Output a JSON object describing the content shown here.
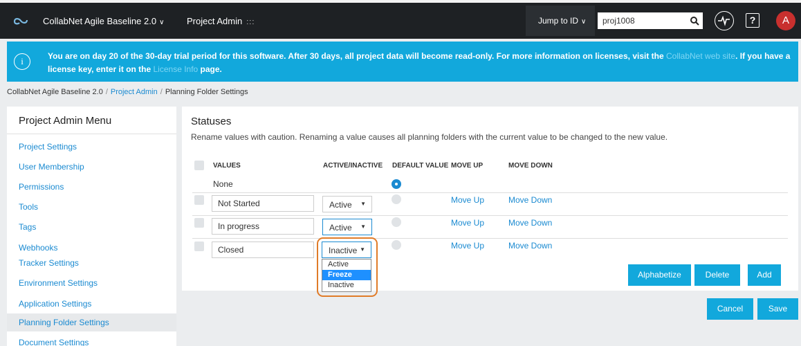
{
  "topbar": {
    "app_title": "CollabNet Agile Baseline 2.0",
    "section_title": "Project Admin",
    "grid_icon": ":::",
    "jump_label": "Jump to ID",
    "search_value": "proj1008",
    "help_glyph": "?",
    "avatar_letter": "A",
    "colors": {
      "bar": "#1e2124",
      "avatar": "#c8302e"
    }
  },
  "banner": {
    "icon": "i",
    "text_1": "You are on day 20 of the 30-day trial period for this software. After 30 days, all project data will become read-only. For more information on licenses, visit the ",
    "link_1": "CollabNet web site",
    "text_2": ". If you have a license key, enter it on the ",
    "link_2": "License Info",
    "text_3": " page.",
    "color": "#12a8dc"
  },
  "breadcrumb": {
    "items": [
      "CollabNet Agile Baseline 2.0",
      "Project Admin",
      "Planning Folder Settings"
    ],
    "separator": "/"
  },
  "sidebar": {
    "title": "Project Admin Menu",
    "items": [
      "Project Settings",
      "User Membership",
      "Permissions",
      "Tools",
      "Tags",
      "Webhooks",
      "Tracker Settings",
      "Environment Settings",
      "Application Settings",
      "Planning Folder Settings",
      "Document Settings"
    ],
    "active_item": "Planning Folder Settings"
  },
  "statuses": {
    "title": "Statuses",
    "description": "Rename values with caution. Renaming a value causes all planning folders with the current value to be changed to the new value.",
    "columns": [
      "VALUES",
      "ACTIVE/INACTIVE",
      "DEFAULT VALUE",
      "MOVE UP",
      "MOVE DOWN"
    ],
    "rows": [
      {
        "value": "None",
        "default": true
      },
      {
        "value": "Not Started",
        "state": "Active",
        "default": false,
        "move_up": "Move Up",
        "move_down": "Move Down"
      },
      {
        "value": "In progress",
        "state": "Active",
        "default": false,
        "move_up": "Move Up",
        "move_down": "Move Down"
      },
      {
        "value": "Closed",
        "state": "Inactive",
        "default": false,
        "move_up": "Move Up",
        "move_down": "Move Down"
      }
    ],
    "dropdown_open": {
      "options": [
        "Active",
        "Freeze",
        "Inactive"
      ],
      "highlighted": "Freeze"
    },
    "buttons": {
      "alphabetize": "Alphabetize",
      "delete": "Delete",
      "add": "Add"
    }
  },
  "footer_buttons": {
    "cancel": "Cancel",
    "save": "Save"
  },
  "accent_color": "#1a8ad1",
  "highlight_ring_color": "#e07b28"
}
